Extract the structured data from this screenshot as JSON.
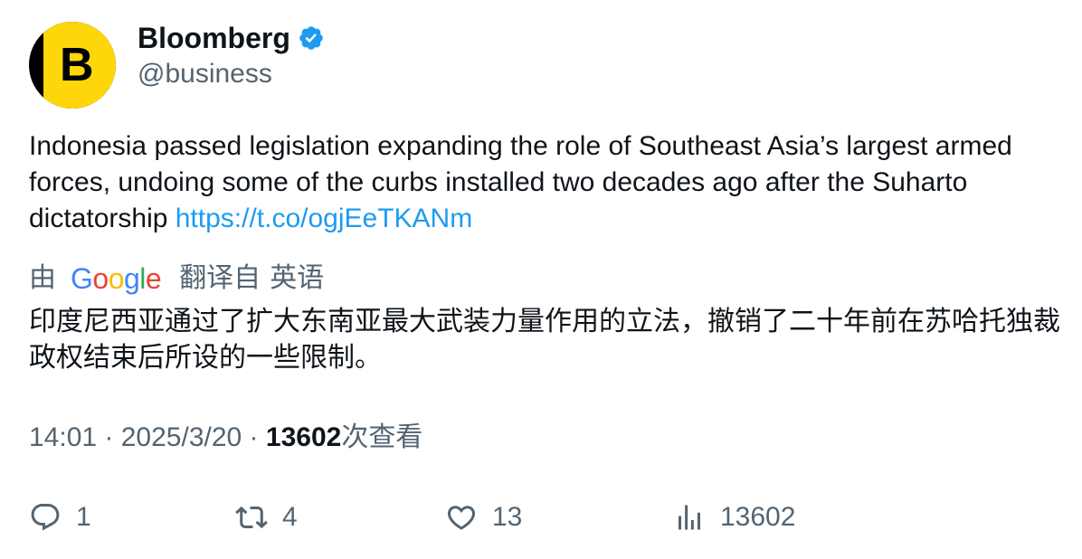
{
  "author": {
    "display_name": "Bloomberg",
    "handle": "@business",
    "avatar_letter": "B",
    "verified": true,
    "avatar_colors": {
      "bg": "#000000",
      "accent": "#ffd60a"
    }
  },
  "tweet": {
    "text": "Indonesia passed legislation expanding the role of Southeast Asia’s largest armed forces, undoing some of the curbs installed two decades ago after the Suharto dictatorship ",
    "link": "https://t.co/ogjEeTKANm"
  },
  "translation": {
    "by": "由",
    "provider": "Google",
    "translated_from": "翻译自",
    "source_language": "英语",
    "text": "印度尼西亚通过了扩大东南亚最大武装力量作用的立法，撤销了二十年前在苏哈托独裁政权结束后所设的一些限制。"
  },
  "meta": {
    "time": "14:01",
    "date": "2025/3/20",
    "separator": " · ",
    "views": "13602",
    "views_label": "次查看"
  },
  "actions": {
    "replies": "1",
    "retweets": "4",
    "likes": "13",
    "views": "13602"
  },
  "colors": {
    "text": "#0f1419",
    "secondary": "#536471",
    "link": "#1d9bf0",
    "verified": "#1d9bf0"
  }
}
